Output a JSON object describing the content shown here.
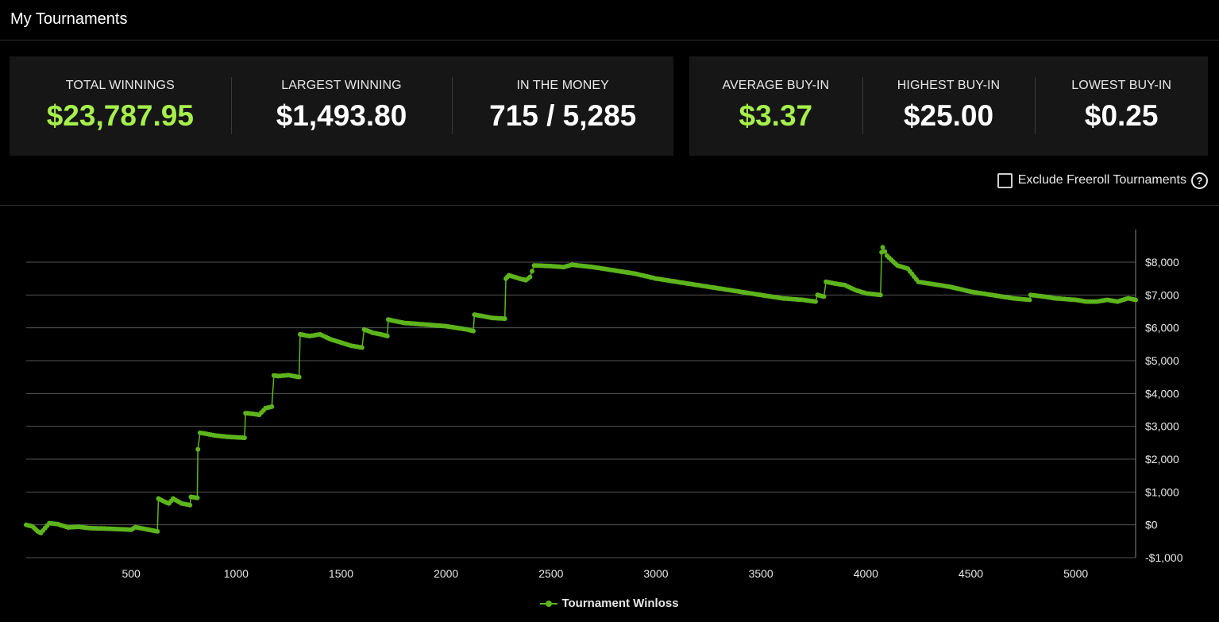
{
  "header": {
    "title": "My Tournaments"
  },
  "stats_left": [
    {
      "label": "TOTAL WINNINGS",
      "value": "$23,787.95",
      "highlight": true
    },
    {
      "label": "LARGEST WINNING",
      "value": "$1,493.80",
      "highlight": false
    },
    {
      "label": "IN THE MONEY",
      "value": "715 / 5,285",
      "highlight": false
    }
  ],
  "stats_right": [
    {
      "label": "AVERAGE BUY-IN",
      "value": "$3.37",
      "highlight": true
    },
    {
      "label": "HIGHEST BUY-IN",
      "value": "$25.00",
      "highlight": false
    },
    {
      "label": "LOWEST BUY-IN",
      "value": "$0.25",
      "highlight": false
    }
  ],
  "filter": {
    "label": "Exclude Freeroll Tournaments",
    "checked": false,
    "help_icon": "question-circle-icon"
  },
  "colors": {
    "accent": "#a6f04b",
    "series": "#5db41c",
    "background": "#000000",
    "card": "#161616"
  },
  "chart_data": {
    "type": "line",
    "title": "",
    "xlabel": "",
    "ylabel": "",
    "xlim": [
      0,
      5285
    ],
    "ylim": [
      -1000,
      8500
    ],
    "x_ticks": [
      500,
      1000,
      1500,
      2000,
      2500,
      3000,
      3500,
      4000,
      4500,
      5000
    ],
    "x_tick_labels": [
      "500",
      "1000",
      "1500",
      "2000",
      "2500",
      "3000",
      "3500",
      "4000",
      "4500",
      "5000"
    ],
    "y_ticks": [
      -1000,
      0,
      1000,
      2000,
      3000,
      4000,
      5000,
      6000,
      7000,
      8000
    ],
    "y_tick_labels": [
      "-$1,000",
      "$0",
      "$1,000",
      "$2,000",
      "$3,000",
      "$4,000",
      "$5,000",
      "$6,000",
      "$7,000",
      "$8,000"
    ],
    "y_axis_side": "right",
    "grid": true,
    "legend_position": "bottom-center",
    "series": [
      {
        "name": "Tournament Winloss",
        "color": "#5db41c",
        "x": [
          0,
          30,
          55,
          70,
          110,
          150,
          200,
          250,
          300,
          400,
          500,
          520,
          560,
          625,
          630,
          660,
          680,
          700,
          740,
          780,
          785,
          815,
          818,
          828,
          850,
          900,
          960,
          1040,
          1045,
          1080,
          1110,
          1140,
          1170,
          1180,
          1200,
          1250,
          1300,
          1305,
          1350,
          1400,
          1450,
          1500,
          1550,
          1600,
          1610,
          1650,
          1690,
          1720,
          1725,
          1760,
          1800,
          1900,
          2000,
          2100,
          2130,
          2135,
          2180,
          2220,
          2280,
          2285,
          2300,
          2350,
          2380,
          2400,
          2420,
          2500,
          2560,
          2600,
          2700,
          2800,
          2900,
          3000,
          3100,
          3200,
          3300,
          3400,
          3500,
          3600,
          3700,
          3760,
          3770,
          3800,
          3810,
          3850,
          3900,
          3950,
          4000,
          4070,
          4075,
          4080,
          4100,
          4150,
          4200,
          4250,
          4300,
          4350,
          4400,
          4500,
          4600,
          4700,
          4780,
          4785,
          4850,
          4900,
          5000,
          5050,
          5100,
          5150,
          5200,
          5250,
          5285
        ],
        "y": [
          0,
          -50,
          -200,
          -250,
          50,
          20,
          -80,
          -60,
          -100,
          -120,
          -150,
          -70,
          -120,
          -200,
          800,
          700,
          650,
          800,
          650,
          600,
          850,
          820,
          2300,
          2800,
          2780,
          2720,
          2680,
          2650,
          3400,
          3380,
          3350,
          3550,
          3600,
          4550,
          4530,
          4560,
          4500,
          5800,
          5750,
          5800,
          5650,
          5550,
          5450,
          5400,
          5950,
          5850,
          5800,
          5750,
          6250,
          6200,
          6150,
          6100,
          6050,
          5950,
          5900,
          6400,
          6350,
          6300,
          6280,
          7500,
          7600,
          7500,
          7450,
          7550,
          7900,
          7880,
          7850,
          7920,
          7850,
          7750,
          7650,
          7500,
          7400,
          7300,
          7200,
          7100,
          7000,
          6900,
          6850,
          6800,
          7000,
          6950,
          7400,
          7350,
          7300,
          7150,
          7050,
          7000,
          8300,
          8450,
          8200,
          7900,
          7800,
          7400,
          7350,
          7300,
          7250,
          7100,
          7000,
          6900,
          6850,
          7000,
          6950,
          6900,
          6850,
          6800,
          6800,
          6850,
          6800,
          6900,
          6850
        ]
      }
    ]
  }
}
